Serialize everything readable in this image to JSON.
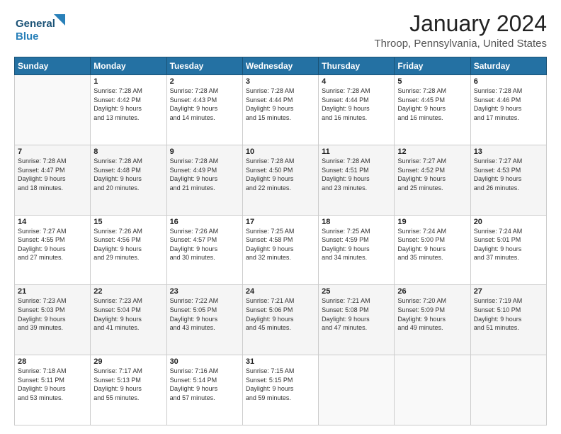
{
  "logo": {
    "line1": "General",
    "line2": "Blue"
  },
  "header": {
    "title": "January 2024",
    "subtitle": "Throop, Pennsylvania, United States"
  },
  "weekdays": [
    "Sunday",
    "Monday",
    "Tuesday",
    "Wednesday",
    "Thursday",
    "Friday",
    "Saturday"
  ],
  "weeks": [
    [
      {
        "day": "",
        "info": ""
      },
      {
        "day": "1",
        "info": "Sunrise: 7:28 AM\nSunset: 4:42 PM\nDaylight: 9 hours\nand 13 minutes."
      },
      {
        "day": "2",
        "info": "Sunrise: 7:28 AM\nSunset: 4:43 PM\nDaylight: 9 hours\nand 14 minutes."
      },
      {
        "day": "3",
        "info": "Sunrise: 7:28 AM\nSunset: 4:44 PM\nDaylight: 9 hours\nand 15 minutes."
      },
      {
        "day": "4",
        "info": "Sunrise: 7:28 AM\nSunset: 4:44 PM\nDaylight: 9 hours\nand 16 minutes."
      },
      {
        "day": "5",
        "info": "Sunrise: 7:28 AM\nSunset: 4:45 PM\nDaylight: 9 hours\nand 16 minutes."
      },
      {
        "day": "6",
        "info": "Sunrise: 7:28 AM\nSunset: 4:46 PM\nDaylight: 9 hours\nand 17 minutes."
      }
    ],
    [
      {
        "day": "7",
        "info": "Sunrise: 7:28 AM\nSunset: 4:47 PM\nDaylight: 9 hours\nand 18 minutes."
      },
      {
        "day": "8",
        "info": "Sunrise: 7:28 AM\nSunset: 4:48 PM\nDaylight: 9 hours\nand 20 minutes."
      },
      {
        "day": "9",
        "info": "Sunrise: 7:28 AM\nSunset: 4:49 PM\nDaylight: 9 hours\nand 21 minutes."
      },
      {
        "day": "10",
        "info": "Sunrise: 7:28 AM\nSunset: 4:50 PM\nDaylight: 9 hours\nand 22 minutes."
      },
      {
        "day": "11",
        "info": "Sunrise: 7:28 AM\nSunset: 4:51 PM\nDaylight: 9 hours\nand 23 minutes."
      },
      {
        "day": "12",
        "info": "Sunrise: 7:27 AM\nSunset: 4:52 PM\nDaylight: 9 hours\nand 25 minutes."
      },
      {
        "day": "13",
        "info": "Sunrise: 7:27 AM\nSunset: 4:53 PM\nDaylight: 9 hours\nand 26 minutes."
      }
    ],
    [
      {
        "day": "14",
        "info": "Sunrise: 7:27 AM\nSunset: 4:55 PM\nDaylight: 9 hours\nand 27 minutes."
      },
      {
        "day": "15",
        "info": "Sunrise: 7:26 AM\nSunset: 4:56 PM\nDaylight: 9 hours\nand 29 minutes."
      },
      {
        "day": "16",
        "info": "Sunrise: 7:26 AM\nSunset: 4:57 PM\nDaylight: 9 hours\nand 30 minutes."
      },
      {
        "day": "17",
        "info": "Sunrise: 7:25 AM\nSunset: 4:58 PM\nDaylight: 9 hours\nand 32 minutes."
      },
      {
        "day": "18",
        "info": "Sunrise: 7:25 AM\nSunset: 4:59 PM\nDaylight: 9 hours\nand 34 minutes."
      },
      {
        "day": "19",
        "info": "Sunrise: 7:24 AM\nSunset: 5:00 PM\nDaylight: 9 hours\nand 35 minutes."
      },
      {
        "day": "20",
        "info": "Sunrise: 7:24 AM\nSunset: 5:01 PM\nDaylight: 9 hours\nand 37 minutes."
      }
    ],
    [
      {
        "day": "21",
        "info": "Sunrise: 7:23 AM\nSunset: 5:03 PM\nDaylight: 9 hours\nand 39 minutes."
      },
      {
        "day": "22",
        "info": "Sunrise: 7:23 AM\nSunset: 5:04 PM\nDaylight: 9 hours\nand 41 minutes."
      },
      {
        "day": "23",
        "info": "Sunrise: 7:22 AM\nSunset: 5:05 PM\nDaylight: 9 hours\nand 43 minutes."
      },
      {
        "day": "24",
        "info": "Sunrise: 7:21 AM\nSunset: 5:06 PM\nDaylight: 9 hours\nand 45 minutes."
      },
      {
        "day": "25",
        "info": "Sunrise: 7:21 AM\nSunset: 5:08 PM\nDaylight: 9 hours\nand 47 minutes."
      },
      {
        "day": "26",
        "info": "Sunrise: 7:20 AM\nSunset: 5:09 PM\nDaylight: 9 hours\nand 49 minutes."
      },
      {
        "day": "27",
        "info": "Sunrise: 7:19 AM\nSunset: 5:10 PM\nDaylight: 9 hours\nand 51 minutes."
      }
    ],
    [
      {
        "day": "28",
        "info": "Sunrise: 7:18 AM\nSunset: 5:11 PM\nDaylight: 9 hours\nand 53 minutes."
      },
      {
        "day": "29",
        "info": "Sunrise: 7:17 AM\nSunset: 5:13 PM\nDaylight: 9 hours\nand 55 minutes."
      },
      {
        "day": "30",
        "info": "Sunrise: 7:16 AM\nSunset: 5:14 PM\nDaylight: 9 hours\nand 57 minutes."
      },
      {
        "day": "31",
        "info": "Sunrise: 7:15 AM\nSunset: 5:15 PM\nDaylight: 9 hours\nand 59 minutes."
      },
      {
        "day": "",
        "info": ""
      },
      {
        "day": "",
        "info": ""
      },
      {
        "day": "",
        "info": ""
      }
    ]
  ]
}
